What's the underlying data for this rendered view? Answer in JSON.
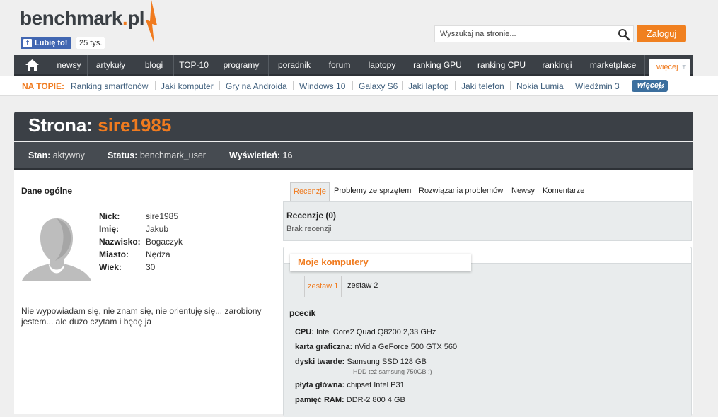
{
  "header": {
    "logo_main": "benchmark",
    "logo_dot": ".",
    "logo_tld": "pl",
    "fb_like": "Lubię to!",
    "fb_count": "25 tys.",
    "search_placeholder": "Wyszukaj na stronie...",
    "login": "Zaloguj"
  },
  "nav": {
    "items": [
      "newsy",
      "artykuły",
      "blogi",
      "TOP-10",
      "programy",
      "poradnik",
      "forum",
      "laptopy",
      "ranking GPU",
      "ranking CPU",
      "rankingi",
      "marketplace"
    ],
    "more": "więcej"
  },
  "topbar": {
    "label": "NA TOPIE:",
    "topics": [
      "Ranking smartfonów",
      "Jaki komputer",
      "Gry na Androida",
      "Windows 10",
      "Galaxy S6",
      "Jaki laptop",
      "Jaki telefon",
      "Nokia Lumia",
      "Wiedźmin 3"
    ],
    "more": "więcej"
  },
  "page": {
    "title_prefix": "Strona:",
    "title_user": "sire1985",
    "status": [
      {
        "label": "Stan:",
        "value": "aktywny"
      },
      {
        "label": "Status:",
        "value": "benchmark_user"
      },
      {
        "label": "Wyświetleń:",
        "value": "16"
      }
    ]
  },
  "profile": {
    "section_title": "Dane ogólne",
    "fields": [
      {
        "label": "Nick:",
        "value": "sire1985"
      },
      {
        "label": "Imię:",
        "value": "Jakub"
      },
      {
        "label": "Nazwisko:",
        "value": "Bogaczyk"
      },
      {
        "label": "Miasto:",
        "value": "Nędza"
      },
      {
        "label": "Wiek:",
        "value": "30"
      }
    ],
    "bio": "Nie wypowiadam się, nie znam się, nie orientuję się... zarobiony jestem... ale dużo czytam i będę ja"
  },
  "tabs": [
    "Recenzje",
    "Problemy ze sprzętem",
    "Rozwiązania problemów",
    "Newsy",
    "Komentarze"
  ],
  "reviews": {
    "heading": "Recenzje (0)",
    "empty": "Brak recenzji"
  },
  "computers": {
    "title": "Moje komputery",
    "tabs": [
      "zestaw 1",
      "zestaw 2"
    ],
    "pc_name": "pcecik",
    "specs": [
      {
        "label": "CPU:",
        "value": "Intel Core2 Quad Q8200 2,33 GHz"
      },
      {
        "label": "karta graficzna:",
        "value": "nVidia GeForce 500 GTX 560"
      },
      {
        "label": "dyski twarde:",
        "value": "Samsung SSD 128 GB",
        "sub": "HDD też samsung 750GB :)"
      },
      {
        "label": "płyta główna:",
        "value": "chipset Intel P31"
      },
      {
        "label": "pamięć RAM:",
        "value": "DDR-2 800 4 GB"
      }
    ]
  },
  "colors": {
    "accent": "#f07b1f",
    "dark": "#3b4046",
    "link": "#3e5e7c"
  }
}
